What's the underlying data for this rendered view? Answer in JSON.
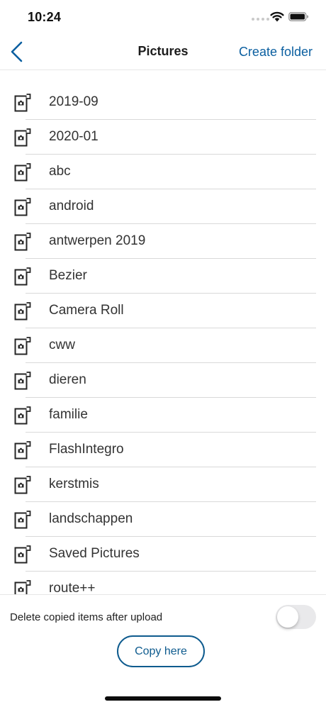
{
  "status_bar": {
    "time": "10:24"
  },
  "navbar": {
    "title": "Pictures",
    "action_label": "Create folder"
  },
  "folders": [
    {
      "label": "2019-09"
    },
    {
      "label": "2020-01"
    },
    {
      "label": "abc"
    },
    {
      "label": "android"
    },
    {
      "label": "antwerpen 2019"
    },
    {
      "label": "Bezier"
    },
    {
      "label": "Camera Roll"
    },
    {
      "label": "cww"
    },
    {
      "label": "dieren"
    },
    {
      "label": "familie"
    },
    {
      "label": "FlashIntegro"
    },
    {
      "label": "kerstmis"
    },
    {
      "label": "landschappen"
    },
    {
      "label": "Saved Pictures"
    },
    {
      "label": "route++"
    }
  ],
  "footer": {
    "toggle_label": "Delete copied items after upload",
    "toggle_on": false,
    "copy_button_label": "Copy here"
  },
  "colors": {
    "accent": "#0b5fa0",
    "separator": "#d9d9d9",
    "toggle_off": "#e9e9eb"
  },
  "icons": {
    "row_icon": "picture-folder-icon",
    "back": "chevron-left-icon"
  }
}
